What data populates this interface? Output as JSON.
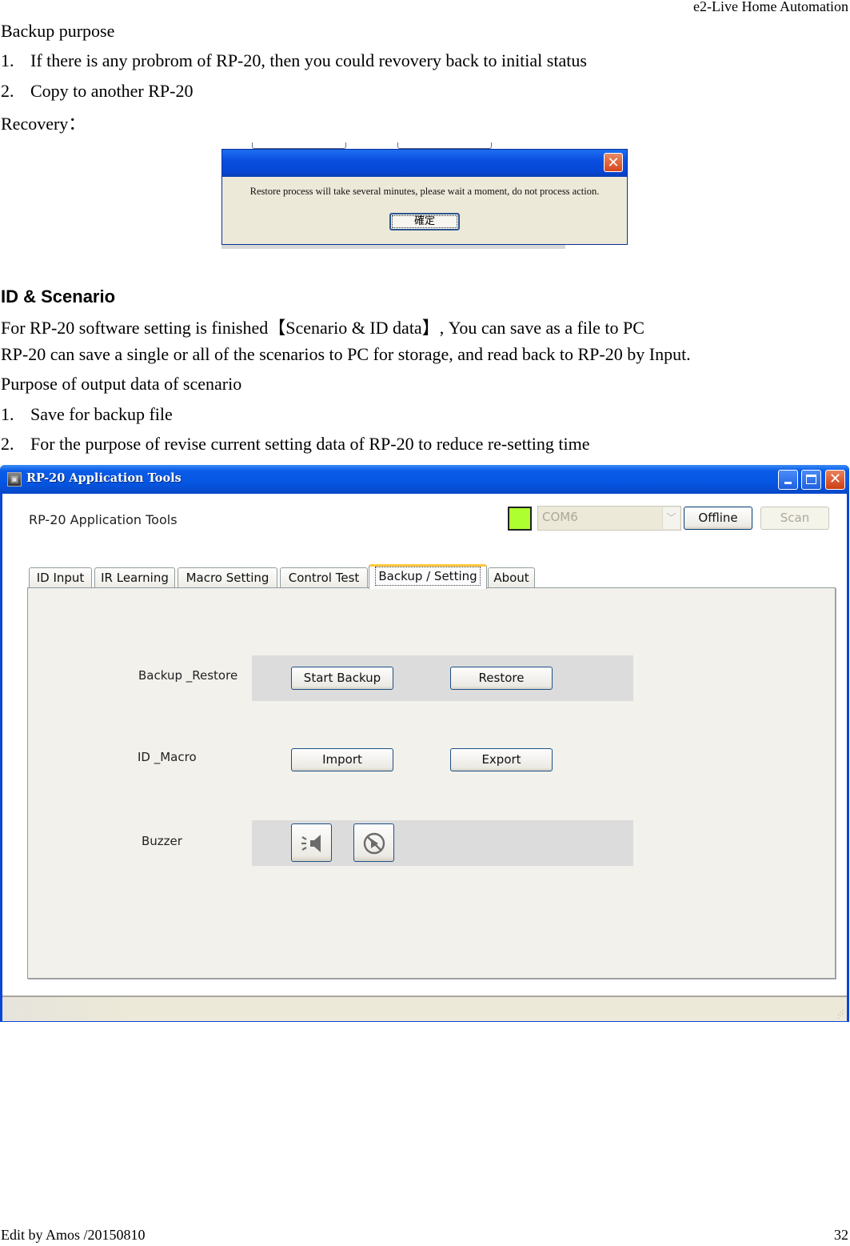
{
  "header": {
    "right_text": "e2-Live Home Automation"
  },
  "backup_section": {
    "title": "Backup purpose",
    "items": [
      {
        "num": "1.",
        "text": "If there is any probrom of RP-20, then you could revovery back to initial status"
      },
      {
        "num": "2.",
        "text": "Copy to another RP-20"
      }
    ],
    "recovery_label": "Recovery："
  },
  "dialog": {
    "message": "Restore process will take several minutes, please wait a moment, do not process action.",
    "ok_label": "確定",
    "close_glyph": "✕"
  },
  "id_scenario_section": {
    "heading": "ID & Scenario",
    "line1_prefix": "For RP-20 software setting is finished【",
    "line1_bracket": "Scenario & ID data",
    "line1_suffix": "】, You can save as a file to PC",
    "line2": "RP-20 can save a single or all of the scenarios to PC for storage, and read back to RP-20 by Input.",
    "line3": "Purpose of output data of scenario",
    "items": [
      {
        "num": "1.",
        "text": "Save for backup file"
      },
      {
        "num": "2.",
        "text": "For the purpose of revise current setting data of RP-20 to reduce re-setting time"
      }
    ]
  },
  "app": {
    "window_title": "RP-20 Application Tools",
    "app_label": "RP-20 Application Tools",
    "status_led_color": "#adff2f",
    "com_port": {
      "selected": "COM6"
    },
    "offline_label": "Offline",
    "scan_label": "Scan",
    "tabs": [
      {
        "label": "ID Input",
        "active": false
      },
      {
        "label": "IR Learning",
        "active": false
      },
      {
        "label": "Macro Setting",
        "active": false
      },
      {
        "label": "Control Test",
        "active": false
      },
      {
        "label": "Backup / Setting",
        "active": true
      },
      {
        "label": "About",
        "active": false
      }
    ],
    "rows": {
      "backup_restore": {
        "label": "Backup _Restore",
        "start_backup": "Start Backup",
        "restore": "Restore"
      },
      "id_macro": {
        "label": "ID _Macro",
        "import": "Import",
        "export": "Export"
      },
      "buzzer": {
        "label": "Buzzer",
        "on_icon": "speaker-on-icon",
        "off_icon": "speaker-mute-icon"
      }
    }
  },
  "footer": {
    "left": "Edit by Amos /20150810",
    "page_number": "32"
  }
}
